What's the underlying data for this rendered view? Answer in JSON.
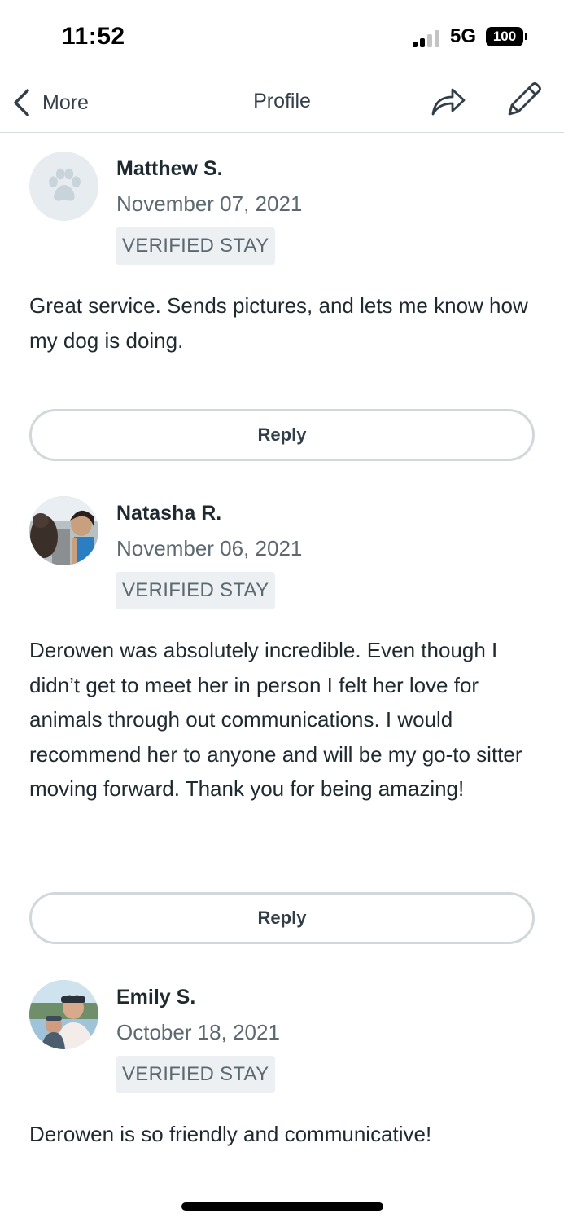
{
  "status_bar": {
    "time": "11:52",
    "network": "5G",
    "battery": "100"
  },
  "nav": {
    "back_label": "More",
    "title": "Profile"
  },
  "reviews": [
    {
      "name": "Matthew S.",
      "date": "November 07, 2021",
      "badge": "VERIFIED STAY",
      "text": "Great service. Sends pictures, and lets me know how my dog is doing.",
      "reply_label": "Reply",
      "avatar": "paw-icon"
    },
    {
      "name": "Natasha R.",
      "date": "November 06, 2021",
      "badge": "VERIFIED STAY",
      "text": "Derowen was absolutely incredible. Even though I didn’t get to meet her in person I felt her love for animals through out communications. I would recommend her to anyone and will be my go-to sitter moving forward. Thank you for being amazing!",
      "reply_label": "Reply",
      "avatar": "photo"
    },
    {
      "name": "Emily S.",
      "date": "October 18, 2021",
      "badge": "VERIFIED STAY",
      "text": "Derowen is so friendly and communicative!",
      "avatar": "photo"
    }
  ]
}
